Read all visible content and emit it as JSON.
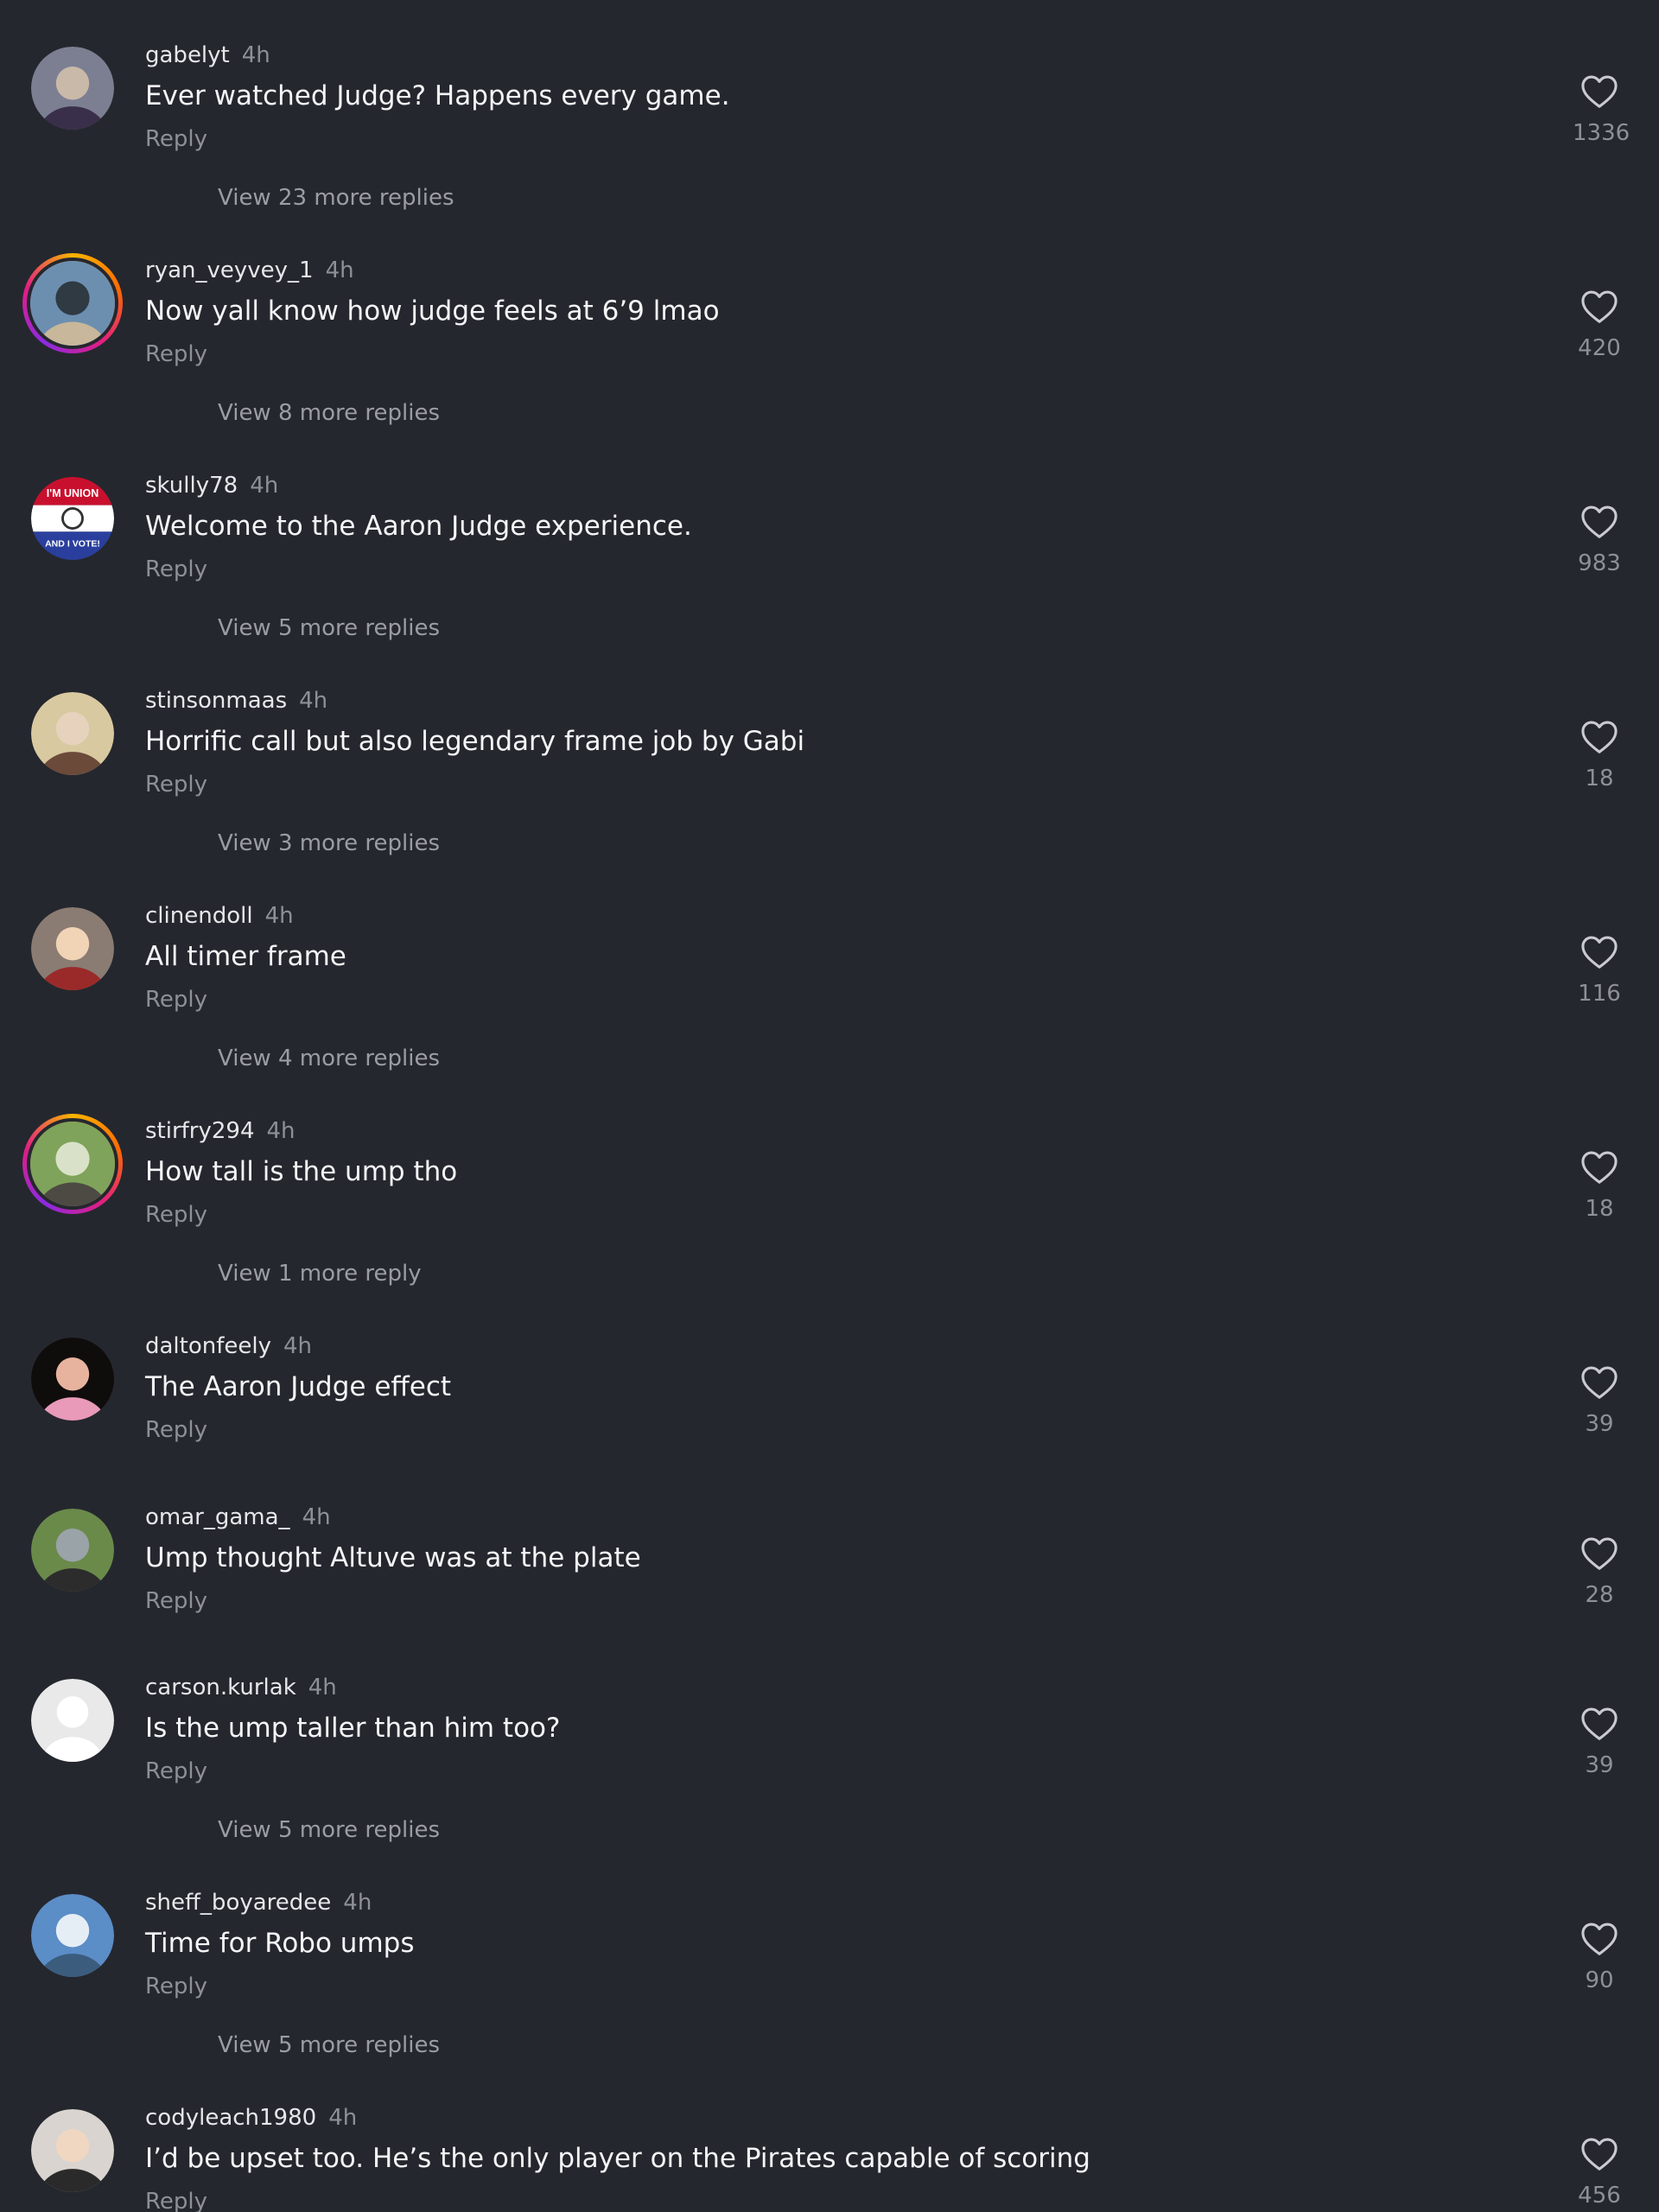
{
  "ui": {
    "reply_label": "Reply",
    "colors": {
      "background": "#25272e",
      "text_primary": "#f4f5f7",
      "text_secondary": "#8d9096"
    },
    "like_icon": "heart-outline-icon"
  },
  "comments": [
    {
      "username": "gabelyt",
      "time": "4h",
      "text": "Ever watched Judge? Happens every game.",
      "likes": "1336",
      "view_more": "View 23 more replies",
      "avatar": "photo",
      "story_ring": false
    },
    {
      "username": "ryan_veyvey_1",
      "time": "4h",
      "text": "Now yall know how judge feels at 6’9 lmao",
      "likes": "420",
      "view_more": "View 8 more replies",
      "avatar": "photo",
      "story_ring": true
    },
    {
      "username": "skully78",
      "time": "4h",
      "text": "Welcome to the Aaron Judge experience.",
      "likes": "983",
      "view_more": "View 5 more replies",
      "avatar": "badge",
      "avatar_text_top": "I'M UNION",
      "avatar_text_bottom": "AND I VOTE!",
      "story_ring": false
    },
    {
      "username": "stinsonmaas",
      "time": "4h",
      "text": "Horrific call but also legendary frame job by Gabi",
      "likes": "18",
      "view_more": "View 3 more replies",
      "avatar": "photo",
      "story_ring": false
    },
    {
      "username": "clinendoll",
      "time": "4h",
      "text": "All timer frame",
      "likes": "116",
      "view_more": "View 4 more replies",
      "avatar": "photo",
      "story_ring": false
    },
    {
      "username": "stirfry294",
      "time": "4h",
      "text": "How tall is the ump tho",
      "likes": "18",
      "view_more": "View 1 more reply",
      "avatar": "photo",
      "story_ring": true
    },
    {
      "username": "daltonfeely",
      "time": "4h",
      "text": "The Aaron Judge effect",
      "likes": "39",
      "view_more": null,
      "avatar": "photo",
      "story_ring": false
    },
    {
      "username": "omar_gama_",
      "time": "4h",
      "text": "Ump thought Altuve was at the plate",
      "likes": "28",
      "view_more": null,
      "avatar": "photo",
      "story_ring": false
    },
    {
      "username": "carson.kurlak",
      "time": "4h",
      "text": "Is the ump taller than him too?",
      "likes": "39",
      "view_more": "View 5 more replies",
      "avatar": "default",
      "story_ring": false
    },
    {
      "username": "sheff_boyaredee",
      "time": "4h",
      "text": "Time for Robo umps",
      "likes": "90",
      "view_more": "View 5 more replies",
      "avatar": "photo",
      "story_ring": false
    },
    {
      "username": "codyleach1980",
      "time": "4h",
      "text": "I’d be upset too. He’s the only player on the Pirates capable of scoring",
      "likes": "456",
      "view_more": null,
      "avatar": "photo",
      "story_ring": false
    }
  ]
}
